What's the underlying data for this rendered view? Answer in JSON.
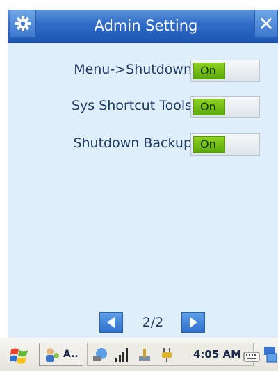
{
  "window": {
    "title": "Admin Setting",
    "close_label": "✕",
    "gear_icon": "gear-icon"
  },
  "settings": [
    {
      "label": "Menu->Shutdown",
      "toggle_label": "On",
      "state": "on"
    },
    {
      "label": "Sys Shortcut Tools",
      "toggle_label": "On",
      "state": "on"
    },
    {
      "label": "Shutdown Backup",
      "toggle_label": "On",
      "state": "on"
    }
  ],
  "pager": {
    "text": "2/2",
    "prev_icon": "arrow-left-icon",
    "next_icon": "arrow-right-icon"
  },
  "taskbar": {
    "start_icon": "windows-start-icon",
    "app_label": "A..",
    "time": "4:05 AM",
    "tray_icons": [
      "network-icon",
      "signal-strength-icon",
      "usb-connection-icon",
      "power-plug-icon"
    ],
    "keyboard_icon": "keyboard-icon"
  },
  "colors": {
    "accent": "#2f6cc8",
    "content_bg": "#dfeefb",
    "toggle_on": "#6bbb0f",
    "label_text": "#1f3a63"
  }
}
